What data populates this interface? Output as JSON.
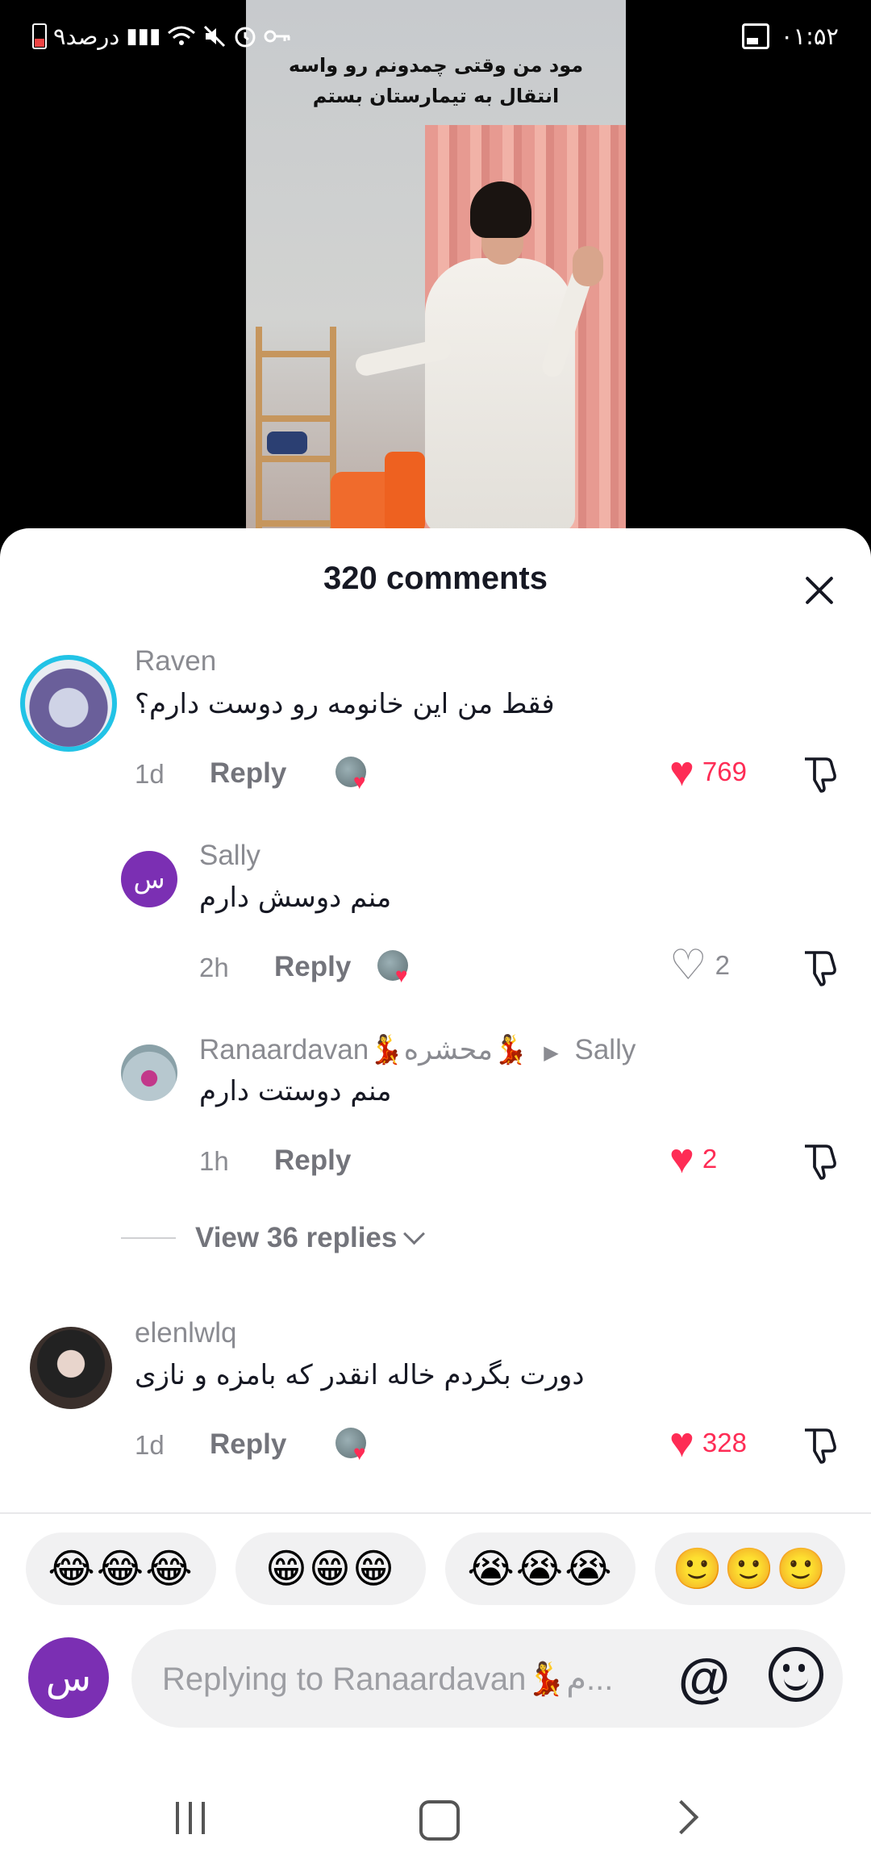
{
  "status_bar": {
    "time": "۰۱:۵۲",
    "battery_text": "۹درصد"
  },
  "video": {
    "caption_line1": "مود من وقتی چمدونم رو واسه",
    "caption_line2": "انتقال به تیمارستان بستم"
  },
  "sheet": {
    "title": "320 comments"
  },
  "comments": [
    {
      "username": "Raven",
      "text": "فقط من این خانومه رو دوست دارم؟",
      "time": "1d",
      "reply": "Reply",
      "likes": "769",
      "liked": true
    },
    {
      "username": "Sally",
      "avatar_letter": "س",
      "text": "منم دوسش دارم",
      "time": "2h",
      "reply": "Reply",
      "likes": "2",
      "liked": false
    },
    {
      "username": "Ranaardavan💃محشره💃",
      "reply_to": "Sally",
      "text": "منم دوستت دارم",
      "time": "1h",
      "reply": "Reply",
      "likes": "2",
      "liked": true
    },
    {
      "username": "elenlwlq",
      "text": "دورت بگردم خاله انقدر که بامزه و نازی",
      "time": "1d",
      "reply": "Reply",
      "likes": "328",
      "liked": true
    }
  ],
  "view_replies": "View 36 replies",
  "emoji_suggestions": [
    "😂😂😂",
    "😁😁😁",
    "😭😭😭",
    "🙂🙂🙂"
  ],
  "input": {
    "avatar_letter": "س",
    "placeholder": "Replying to Ranaardavan💃م...",
    "at_symbol": "@"
  },
  "colors": {
    "like_red": "#fe2c55",
    "text_gray": "#8a8b91",
    "avatar_purple": "#7b2fb3",
    "raven_ring": "#22c3e6"
  }
}
